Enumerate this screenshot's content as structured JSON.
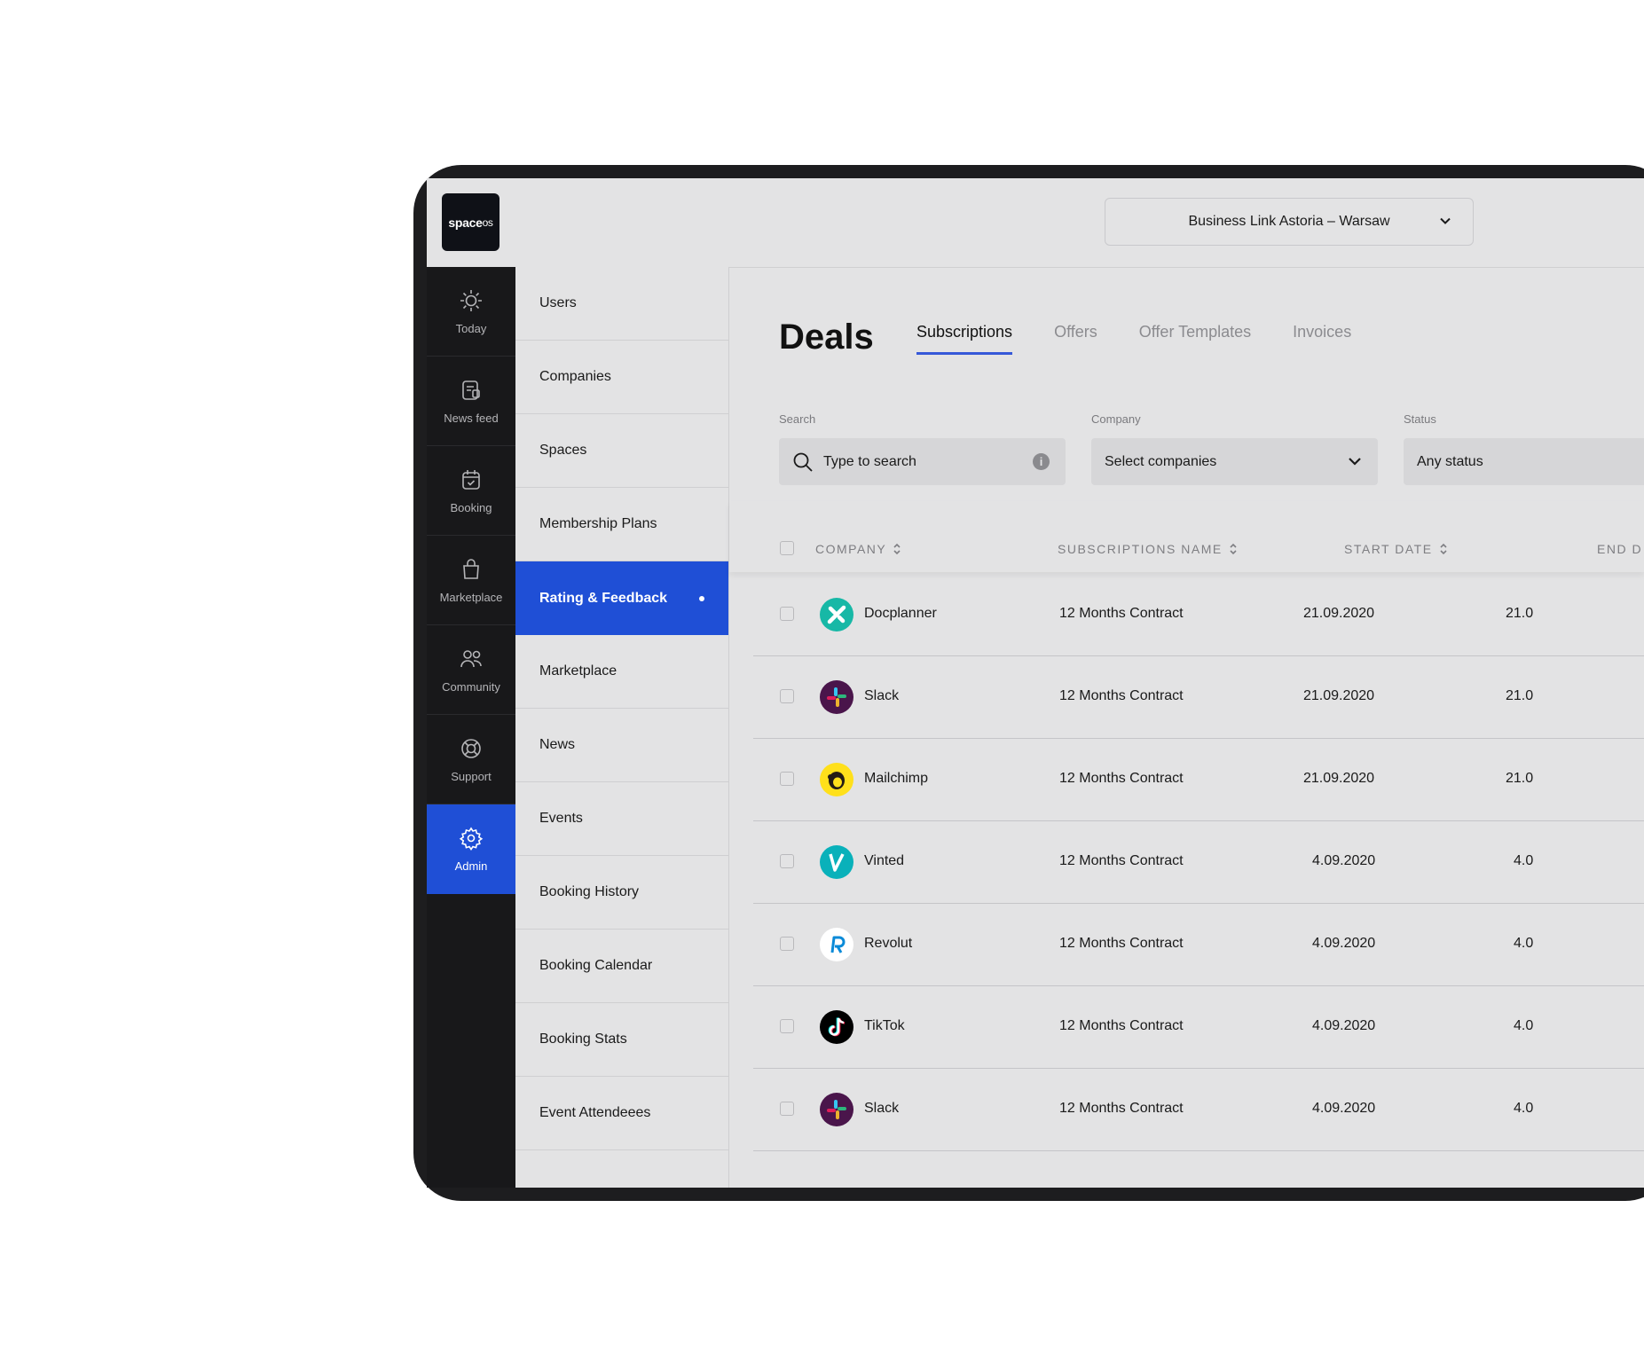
{
  "app": {
    "logo_main": "space",
    "logo_suffix": "os"
  },
  "location_select": {
    "value": "Business Link Astoria – Warsaw"
  },
  "rail": [
    {
      "label": "Today",
      "icon": "sun-icon"
    },
    {
      "label": "News feed",
      "icon": "news-feed-icon"
    },
    {
      "label": "Booking",
      "icon": "calendar-check-icon"
    },
    {
      "label": "Marketplace",
      "icon": "shopping-bag-icon"
    },
    {
      "label": "Community",
      "icon": "users-icon"
    },
    {
      "label": "Support",
      "icon": "lifebuoy-icon"
    },
    {
      "label": "Admin",
      "icon": "gear-icon",
      "active": true
    }
  ],
  "menu": [
    {
      "label": "Users"
    },
    {
      "label": "Companies"
    },
    {
      "label": "Spaces"
    },
    {
      "label": "Membership Plans"
    },
    {
      "label": "Rating & Feedback",
      "active": true
    },
    {
      "label": "Marketplace"
    },
    {
      "label": "News"
    },
    {
      "label": "Events"
    },
    {
      "label": "Booking History"
    },
    {
      "label": "Booking Calendar"
    },
    {
      "label": "Booking Stats"
    },
    {
      "label": "Event Attendeees"
    },
    {
      "label": ""
    }
  ],
  "page": {
    "title": "Deals",
    "tabs": [
      {
        "label": "Subscriptions",
        "active": true
      },
      {
        "label": "Offers"
      },
      {
        "label": "Offer Templates"
      },
      {
        "label": "Invoices"
      }
    ]
  },
  "filters": {
    "search_label": "Search",
    "search_placeholder": "Type to search",
    "company_label": "Company",
    "company_value": "Select companies",
    "status_label": "Status",
    "status_value": "Any status"
  },
  "table": {
    "columns": [
      "COMPANY",
      "SUBSCRIPTIONS NAME",
      "START DATE",
      "END D"
    ],
    "rows": [
      {
        "company": "Docplanner",
        "logo": "docplanner-logo",
        "name": "12 Months Contract",
        "start": "21.09.2020",
        "end": "21.0"
      },
      {
        "company": "Slack",
        "logo": "slack-logo",
        "name": "12 Months Contract",
        "start": "21.09.2020",
        "end": "21.0"
      },
      {
        "company": "Mailchimp",
        "logo": "mailchimp-logo",
        "name": "12 Months Contract",
        "start": "21.09.2020",
        "end": "21.0"
      },
      {
        "company": "Vinted",
        "logo": "vinted-logo",
        "name": "12 Months Contract",
        "start": "4.09.2020",
        "end": "4.0"
      },
      {
        "company": "Revolut",
        "logo": "revolut-logo",
        "name": "12 Months Contract",
        "start": "4.09.2020",
        "end": "4.0"
      },
      {
        "company": "TikTok",
        "logo": "tiktok-logo",
        "name": "12 Months Contract",
        "start": "4.09.2020",
        "end": "4.0"
      },
      {
        "company": "Slack",
        "logo": "slack-logo",
        "name": "12 Months Contract",
        "start": "4.09.2020",
        "end": "4.0"
      }
    ]
  },
  "colors": {
    "accent": "#1f4fd6",
    "rail_bg": "#18181a",
    "surface": "#e3e3e4"
  }
}
